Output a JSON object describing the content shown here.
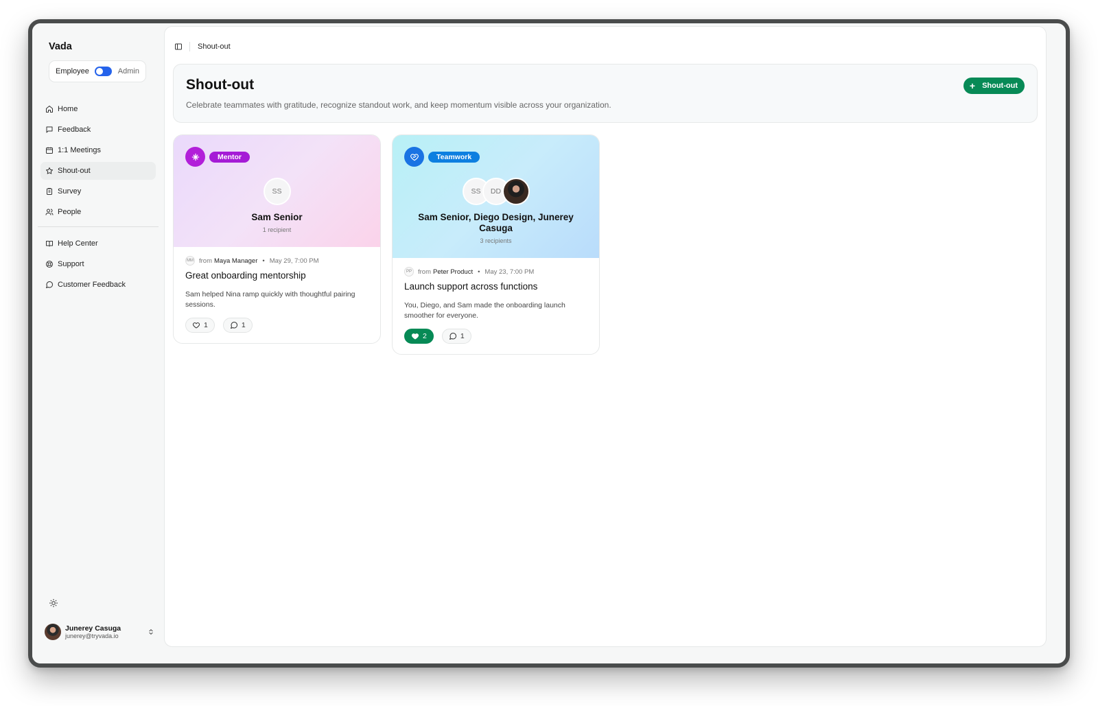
{
  "app": {
    "name": "Vada"
  },
  "role_switch": {
    "left_label": "Employee",
    "right_label": "Admin"
  },
  "nav": {
    "primary": [
      {
        "label": "Home",
        "icon": "home-icon"
      },
      {
        "label": "Feedback",
        "icon": "message-square-icon"
      },
      {
        "label": "1:1 Meetings",
        "icon": "calendar-icon"
      },
      {
        "label": "Shout-out",
        "icon": "star-icon",
        "active": true
      },
      {
        "label": "Survey",
        "icon": "clipboard-icon"
      },
      {
        "label": "People",
        "icon": "users-icon"
      }
    ],
    "secondary": [
      {
        "label": "Help Center",
        "icon": "book-icon"
      },
      {
        "label": "Support",
        "icon": "life-buoy-icon"
      },
      {
        "label": "Customer Feedback",
        "icon": "message-circle-icon"
      }
    ]
  },
  "user": {
    "name": "Junerey Casuga",
    "email": "junerey@tryvada.io"
  },
  "breadcrumb": {
    "current": "Shout-out"
  },
  "page": {
    "title": "Shout-out",
    "subtitle": "Celebrate teammates with gratitude, recognize standout work, and keep momentum visible across your organization.",
    "new_button_label": "Shout-out"
  },
  "shoutouts": [
    {
      "badge": "Mentor",
      "badge_color": "#a51bd6",
      "recipients_avatars": [
        "SS"
      ],
      "recipients": "Sam Senior",
      "recipient_count": "1 recipient",
      "from_initials": "MM",
      "from_prefix": "from",
      "from_name": "Maya Manager",
      "date": "May 29, 7:00 PM",
      "title": "Great onboarding mentorship",
      "message": "Sam helped Nina ramp quickly with thoughtful pairing sessions.",
      "likes": "1",
      "comments": "1",
      "liked": false
    },
    {
      "badge": "Teamwork",
      "badge_color": "#0d7fe0",
      "recipients_avatars": [
        "SS",
        "DD"
      ],
      "recipients": "Sam Senior, Diego Design, Junerey Casuga",
      "recipient_count": "3 recipients",
      "from_initials": "PP",
      "from_prefix": "from",
      "from_name": "Peter Product",
      "date": "May 23, 7:00 PM",
      "title": "Launch support across functions",
      "message": "You, Diego, and Sam made the onboarding launch smoother for everyone.",
      "likes": "2",
      "comments": "1",
      "liked": true
    }
  ],
  "colors": {
    "accent": "#078a56",
    "toggle": "#2563eb"
  }
}
